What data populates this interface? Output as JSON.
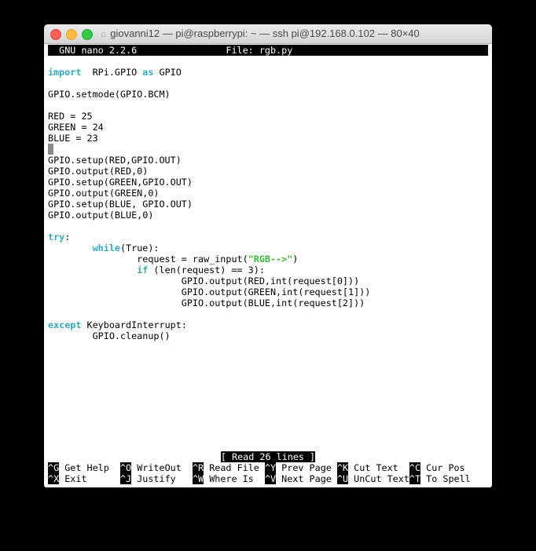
{
  "window": {
    "title": "giovanni12 — pi@raspberrypi: ~ — ssh pi@192.168.0.102 — 80×40"
  },
  "nano": {
    "version": "  GNU nano 2.2.6",
    "file": "File: rgb.py"
  },
  "code": [
    [],
    [
      [
        "kw",
        "import"
      ],
      [
        "",
        "  RPi.GPIO "
      ],
      [
        "kw",
        "as"
      ],
      [
        "",
        " GPIO"
      ]
    ],
    [],
    [
      [
        "",
        "GPIO.setmode(GPIO.BCM)"
      ]
    ],
    [],
    [
      [
        "",
        "RED = 25"
      ]
    ],
    [
      [
        "",
        "GREEN = 24"
      ]
    ],
    [
      [
        "",
        "BLUE = 23"
      ]
    ],
    [
      [
        "cursor",
        ""
      ]
    ],
    [
      [
        "",
        "GPIO.setup(RED,GPIO.OUT)"
      ]
    ],
    [
      [
        "",
        "GPIO.output(RED,0)"
      ]
    ],
    [
      [
        "",
        "GPIO.setup(GREEN,GPIO.OUT)"
      ]
    ],
    [
      [
        "",
        "GPIO.output(GREEN,0)"
      ]
    ],
    [
      [
        "",
        "GPIO.setup(BLUE, GPIO.OUT)"
      ]
    ],
    [
      [
        "",
        "GPIO.output(BLUE,0)"
      ]
    ],
    [],
    [
      [
        "kw",
        "try"
      ],
      [
        "",
        ":"
      ]
    ],
    [
      [
        "",
        "        "
      ],
      [
        "kw",
        "while"
      ],
      [
        "",
        "(True):"
      ]
    ],
    [
      [
        "",
        "                request = raw_input("
      ],
      [
        "str",
        "\"RGB-->\""
      ],
      [
        "",
        ")"
      ]
    ],
    [
      [
        "",
        "                "
      ],
      [
        "kw",
        "if"
      ],
      [
        "",
        " (len(request) == 3):"
      ]
    ],
    [
      [
        "",
        "                        GPIO.output(RED,int(request[0]))"
      ]
    ],
    [
      [
        "",
        "                        GPIO.output(GREEN,int(request[1]))"
      ]
    ],
    [
      [
        "",
        "                        GPIO.output(BLUE,int(request[2]))"
      ]
    ],
    [],
    [
      [
        "kw",
        "except"
      ],
      [
        "",
        " KeyboardInterrupt:"
      ]
    ],
    [
      [
        "",
        "        GPIO.cleanup()"
      ]
    ]
  ],
  "status": "[ Read 26 lines ]",
  "shortcuts": [
    [
      {
        "key": "^G",
        "label": " Get Help  "
      },
      {
        "key": "^O",
        "label": " WriteOut  "
      },
      {
        "key": "^R",
        "label": " Read File "
      },
      {
        "key": "^Y",
        "label": " Prev Page "
      },
      {
        "key": "^K",
        "label": " Cut Text  "
      },
      {
        "key": "^C",
        "label": " Cur Pos"
      }
    ],
    [
      {
        "key": "^X",
        "label": " Exit      "
      },
      {
        "key": "^J",
        "label": " Justify   "
      },
      {
        "key": "^W",
        "label": " Where Is  "
      },
      {
        "key": "^V",
        "label": " Next Page "
      },
      {
        "key": "^U",
        "label": " UnCut Text"
      },
      {
        "key": "^T",
        "label": " To Spell"
      }
    ]
  ]
}
